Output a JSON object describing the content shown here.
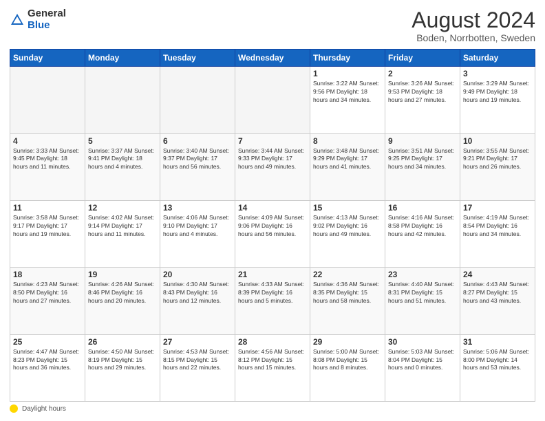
{
  "header": {
    "logo_general": "General",
    "logo_blue": "Blue",
    "month_year": "August 2024",
    "location": "Boden, Norrbotten, Sweden"
  },
  "footer": {
    "label": "Daylight hours"
  },
  "days_of_week": [
    "Sunday",
    "Monday",
    "Tuesday",
    "Wednesday",
    "Thursday",
    "Friday",
    "Saturday"
  ],
  "weeks": [
    [
      {
        "day": "",
        "info": "",
        "empty": true
      },
      {
        "day": "",
        "info": "",
        "empty": true
      },
      {
        "day": "",
        "info": "",
        "empty": true
      },
      {
        "day": "",
        "info": "",
        "empty": true
      },
      {
        "day": "1",
        "info": "Sunrise: 3:22 AM\nSunset: 9:56 PM\nDaylight: 18 hours\nand 34 minutes.",
        "empty": false
      },
      {
        "day": "2",
        "info": "Sunrise: 3:26 AM\nSunset: 9:53 PM\nDaylight: 18 hours\nand 27 minutes.",
        "empty": false
      },
      {
        "day": "3",
        "info": "Sunrise: 3:29 AM\nSunset: 9:49 PM\nDaylight: 18 hours\nand 19 minutes.",
        "empty": false
      }
    ],
    [
      {
        "day": "4",
        "info": "Sunrise: 3:33 AM\nSunset: 9:45 PM\nDaylight: 18 hours\nand 11 minutes.",
        "empty": false
      },
      {
        "day": "5",
        "info": "Sunrise: 3:37 AM\nSunset: 9:41 PM\nDaylight: 18 hours\nand 4 minutes.",
        "empty": false
      },
      {
        "day": "6",
        "info": "Sunrise: 3:40 AM\nSunset: 9:37 PM\nDaylight: 17 hours\nand 56 minutes.",
        "empty": false
      },
      {
        "day": "7",
        "info": "Sunrise: 3:44 AM\nSunset: 9:33 PM\nDaylight: 17 hours\nand 49 minutes.",
        "empty": false
      },
      {
        "day": "8",
        "info": "Sunrise: 3:48 AM\nSunset: 9:29 PM\nDaylight: 17 hours\nand 41 minutes.",
        "empty": false
      },
      {
        "day": "9",
        "info": "Sunrise: 3:51 AM\nSunset: 9:25 PM\nDaylight: 17 hours\nand 34 minutes.",
        "empty": false
      },
      {
        "day": "10",
        "info": "Sunrise: 3:55 AM\nSunset: 9:21 PM\nDaylight: 17 hours\nand 26 minutes.",
        "empty": false
      }
    ],
    [
      {
        "day": "11",
        "info": "Sunrise: 3:58 AM\nSunset: 9:17 PM\nDaylight: 17 hours\nand 19 minutes.",
        "empty": false
      },
      {
        "day": "12",
        "info": "Sunrise: 4:02 AM\nSunset: 9:14 PM\nDaylight: 17 hours\nand 11 minutes.",
        "empty": false
      },
      {
        "day": "13",
        "info": "Sunrise: 4:06 AM\nSunset: 9:10 PM\nDaylight: 17 hours\nand 4 minutes.",
        "empty": false
      },
      {
        "day": "14",
        "info": "Sunrise: 4:09 AM\nSunset: 9:06 PM\nDaylight: 16 hours\nand 56 minutes.",
        "empty": false
      },
      {
        "day": "15",
        "info": "Sunrise: 4:13 AM\nSunset: 9:02 PM\nDaylight: 16 hours\nand 49 minutes.",
        "empty": false
      },
      {
        "day": "16",
        "info": "Sunrise: 4:16 AM\nSunset: 8:58 PM\nDaylight: 16 hours\nand 42 minutes.",
        "empty": false
      },
      {
        "day": "17",
        "info": "Sunrise: 4:19 AM\nSunset: 8:54 PM\nDaylight: 16 hours\nand 34 minutes.",
        "empty": false
      }
    ],
    [
      {
        "day": "18",
        "info": "Sunrise: 4:23 AM\nSunset: 8:50 PM\nDaylight: 16 hours\nand 27 minutes.",
        "empty": false
      },
      {
        "day": "19",
        "info": "Sunrise: 4:26 AM\nSunset: 8:46 PM\nDaylight: 16 hours\nand 20 minutes.",
        "empty": false
      },
      {
        "day": "20",
        "info": "Sunrise: 4:30 AM\nSunset: 8:43 PM\nDaylight: 16 hours\nand 12 minutes.",
        "empty": false
      },
      {
        "day": "21",
        "info": "Sunrise: 4:33 AM\nSunset: 8:39 PM\nDaylight: 16 hours\nand 5 minutes.",
        "empty": false
      },
      {
        "day": "22",
        "info": "Sunrise: 4:36 AM\nSunset: 8:35 PM\nDaylight: 15 hours\nand 58 minutes.",
        "empty": false
      },
      {
        "day": "23",
        "info": "Sunrise: 4:40 AM\nSunset: 8:31 PM\nDaylight: 15 hours\nand 51 minutes.",
        "empty": false
      },
      {
        "day": "24",
        "info": "Sunrise: 4:43 AM\nSunset: 8:27 PM\nDaylight: 15 hours\nand 43 minutes.",
        "empty": false
      }
    ],
    [
      {
        "day": "25",
        "info": "Sunrise: 4:47 AM\nSunset: 8:23 PM\nDaylight: 15 hours\nand 36 minutes.",
        "empty": false
      },
      {
        "day": "26",
        "info": "Sunrise: 4:50 AM\nSunset: 8:19 PM\nDaylight: 15 hours\nand 29 minutes.",
        "empty": false
      },
      {
        "day": "27",
        "info": "Sunrise: 4:53 AM\nSunset: 8:15 PM\nDaylight: 15 hours\nand 22 minutes.",
        "empty": false
      },
      {
        "day": "28",
        "info": "Sunrise: 4:56 AM\nSunset: 8:12 PM\nDaylight: 15 hours\nand 15 minutes.",
        "empty": false
      },
      {
        "day": "29",
        "info": "Sunrise: 5:00 AM\nSunset: 8:08 PM\nDaylight: 15 hours\nand 8 minutes.",
        "empty": false
      },
      {
        "day": "30",
        "info": "Sunrise: 5:03 AM\nSunset: 8:04 PM\nDaylight: 15 hours\nand 0 minutes.",
        "empty": false
      },
      {
        "day": "31",
        "info": "Sunrise: 5:06 AM\nSunset: 8:00 PM\nDaylight: 14 hours\nand 53 minutes.",
        "empty": false
      }
    ]
  ]
}
